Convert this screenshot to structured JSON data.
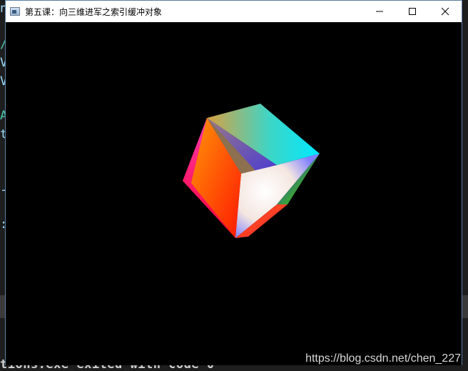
{
  "window": {
    "title": "第五课：向三维进军之索引缓冲对象",
    "icon": "app-window-icon"
  },
  "controls": {
    "minimize_icon": "minimize-icon",
    "maximize_icon": "maximize-icon",
    "close_icon": "close-icon"
  },
  "console": {
    "output_text": "tions.exe exited with code 0"
  },
  "watermark": {
    "text": "https://blog.csdn.net/chen_227"
  },
  "colors": {
    "titlebar": "#ffffff",
    "viewport": "#000000",
    "console_bg": "#1e1e1e",
    "console_cyan": "#4ec9b0"
  }
}
